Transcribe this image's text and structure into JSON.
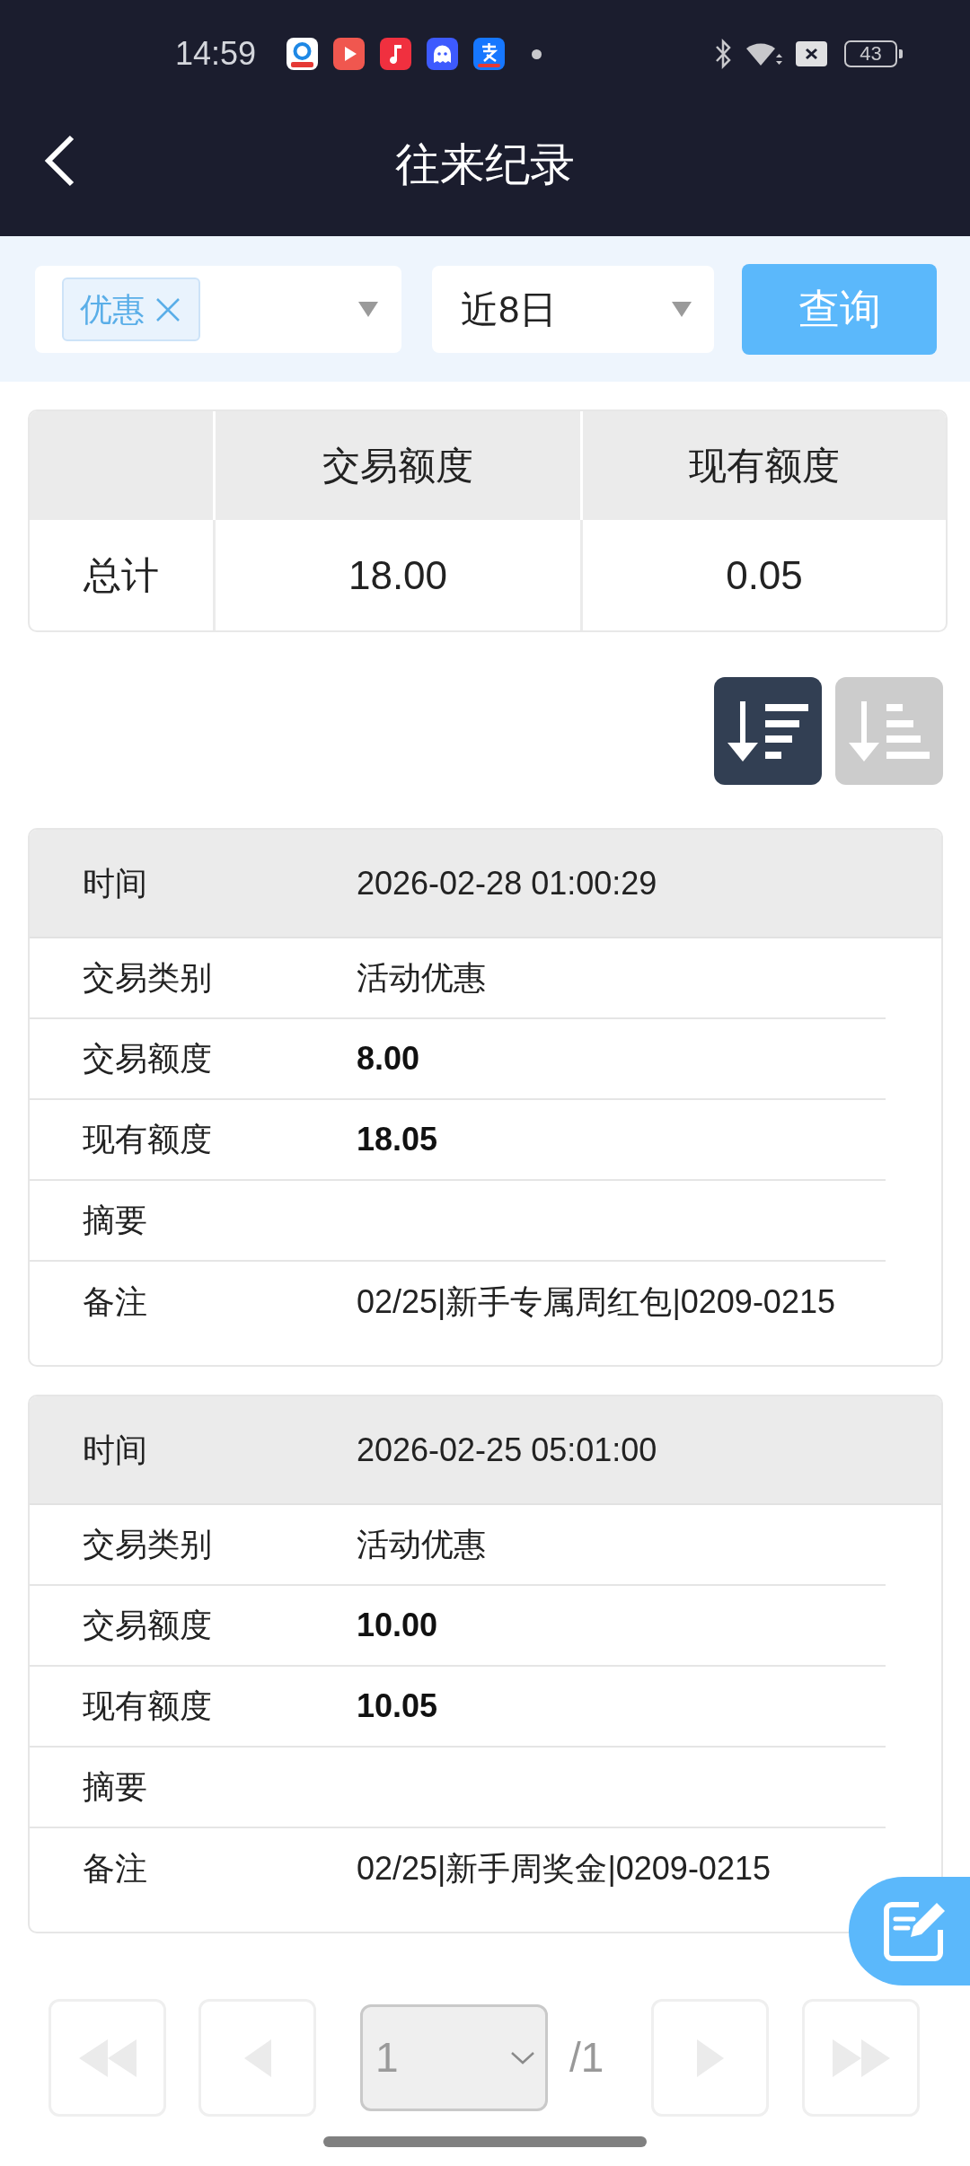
{
  "status_bar": {
    "time": "14:59",
    "battery": "43"
  },
  "header": {
    "title": "往来纪录"
  },
  "filters": {
    "category": {
      "tags": [
        {
          "label": "优惠"
        }
      ]
    },
    "period": {
      "value": "近8日"
    },
    "query_button": "查询"
  },
  "summary_table": {
    "columns": [
      "交易额度",
      "现有额度"
    ],
    "rows": [
      {
        "label": "总计",
        "cells": [
          "18.00",
          "0.05"
        ]
      }
    ]
  },
  "sort_buttons": [
    {
      "kind": "descending",
      "selected": true
    },
    {
      "kind": "ascending",
      "selected": false
    }
  ],
  "records": [
    {
      "header": {
        "label": "时间",
        "value": "2026-02-28 01:00:29"
      },
      "fields": [
        {
          "label": "交易类别",
          "value": "活动优惠",
          "bold": false
        },
        {
          "label": "交易额度",
          "value": "8.00",
          "bold": true
        },
        {
          "label": "现有额度",
          "value": "18.05",
          "bold": true
        },
        {
          "label": "摘要"
        },
        {
          "label": "备注",
          "value": "02/25|新手专属周红包|0209-0215",
          "bold": false
        }
      ]
    },
    {
      "header": {
        "label": "时间",
        "value": "2026-02-25 05:01:00"
      },
      "fields": [
        {
          "label": "交易类别",
          "value": "活动优惠",
          "bold": false
        },
        {
          "label": "交易额度",
          "value": "10.00",
          "bold": true
        },
        {
          "label": "现有额度",
          "value": "10.05",
          "bold": true
        },
        {
          "label": "摘要"
        },
        {
          "label": "备注",
          "value": "02/25|新手周奖金|0209-0215",
          "bold": false
        }
      ]
    }
  ],
  "pagination": {
    "buttons_before": [
      {
        "kind": "first",
        "disabled": true
      },
      {
        "kind": "previous",
        "disabled": true
      }
    ],
    "page": {
      "value": "1",
      "disabled": true
    },
    "total": "/1",
    "buttons_after": [
      {
        "kind": "next",
        "disabled": true
      },
      {
        "kind": "last",
        "disabled": true
      }
    ]
  }
}
